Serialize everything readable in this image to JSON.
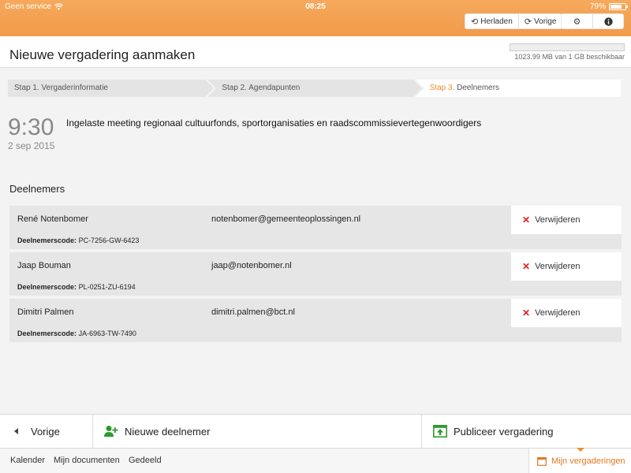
{
  "status": {
    "carrier": "Geen service",
    "time": "08:25",
    "battery": "79%",
    "battery_level": 0.79
  },
  "toolbar": {
    "reload_label": "Herladen",
    "back_label": "Vorige"
  },
  "header": {
    "title": "Nieuwe vergadering aanmaken",
    "storage_text": "1023.99 MB van 1 GB beschikbaar",
    "storage_used_fraction": 0.0
  },
  "steps": [
    {
      "num": "Stap 1.",
      "label": "Vergaderinformatie"
    },
    {
      "num": "Stap 2.",
      "label": "Agendapunten"
    },
    {
      "num": "Stap 3.",
      "label": "Deelnemers"
    }
  ],
  "meeting": {
    "time": "9:30",
    "date": "2 sep 2015",
    "title": "Ingelaste meeting regionaal cultuurfonds, sportorganisaties en raadscommissievertegenwoordigers"
  },
  "participants_label": "Deelnemers",
  "participants": [
    {
      "name": "René Notenbomer",
      "email": "notenbomer@gemeenteoplossingen.nl",
      "code_label": "Deelnemerscode:",
      "code": "PC-7256-GW-6423",
      "remove": "Verwijderen"
    },
    {
      "name": "Jaap Bouman",
      "email": "jaap@notenbomer.nl",
      "code_label": "Deelnemerscode:",
      "code": "PL-0251-ZU-6194",
      "remove": "Verwijderen"
    },
    {
      "name": "Dimitri Palmen",
      "email": "dimitri.palmen@bct.nl",
      "code_label": "Deelnemerscode:",
      "code": "JA-6963-TW-7490",
      "remove": "Verwijderen"
    }
  ],
  "actions": {
    "back": "Vorige",
    "new_participant": "Nieuwe deelnemer",
    "publish": "Publiceer vergadering"
  },
  "tabs": {
    "calendar": "Kalender",
    "documents": "Mijn documenten",
    "shared": "Gedeeld",
    "meetings": "Mijn vergaderingen"
  },
  "colors": {
    "accent": "#f19a4a",
    "remove": "#dd2222",
    "add": "#2e9b2e"
  }
}
